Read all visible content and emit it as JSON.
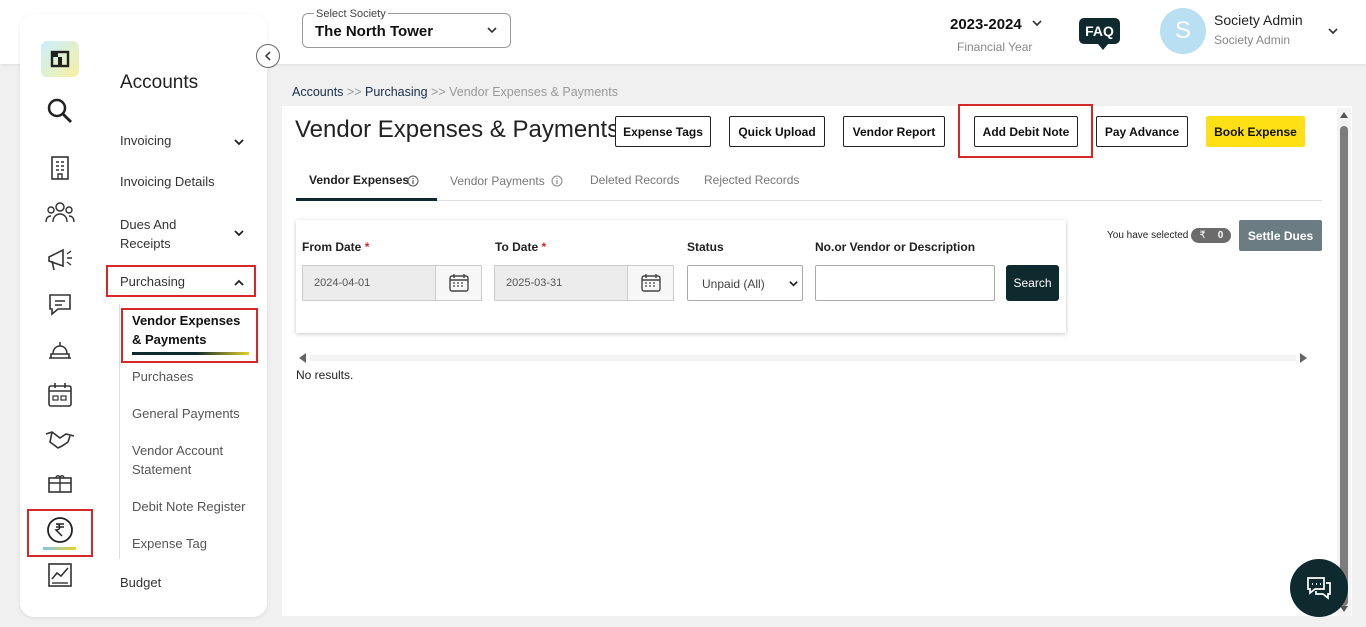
{
  "header": {
    "society_label": "Select Society",
    "society_value": "The North Tower",
    "financial_year": "2023-2024",
    "financial_year_label": "Financial Year",
    "faq_label": "FAQ",
    "user_initial": "S",
    "user_name": "Society Admin",
    "user_role": "Society Admin"
  },
  "sidebar": {
    "section_title": "Accounts",
    "items": {
      "invoicing": "Invoicing",
      "invoicing_details": "Invoicing Details",
      "dues_receipts": "Dues And Receipts",
      "purchasing": "Purchasing",
      "budget": "Budget"
    },
    "purchasing_sub": {
      "vendor_expenses": "Vendor Expenses & Payments",
      "purchases": "Purchases",
      "general_payments": "General Payments",
      "vendor_account_statement": "Vendor Account Statement",
      "debit_note_register": "Debit Note Register",
      "expense_tag": "Expense Tag"
    }
  },
  "breadcrumb": {
    "accounts": "Accounts",
    "sep1": ">>",
    "purchasing": "Purchasing",
    "sep2": ">>",
    "current": "Vendor Expenses & Payments"
  },
  "page": {
    "title": "Vendor Expenses & Payments",
    "buttons": {
      "expense_tags": "Expense Tags",
      "quick_upload": "Quick Upload",
      "vendor_report": "Vendor Report",
      "add_debit_note": "Add Debit Note",
      "pay_advance": "Pay Advance",
      "book_expense": "Book Expense"
    },
    "tabs": {
      "vendor_expenses": "Vendor Expenses",
      "vendor_payments": "Vendor Payments",
      "deleted_records": "Deleted Records",
      "rejected_records": "Rejected Records"
    }
  },
  "filters": {
    "from_date_label": "From Date",
    "from_date_value": "2024-04-01",
    "to_date_label": "To Date",
    "to_date_value": "2025-03-31",
    "required_mark": "*",
    "status_label": "Status",
    "status_value": "Unpaid (All)",
    "search_label": "No.or Vendor or Description",
    "search_value": "",
    "search_button": "Search"
  },
  "selection": {
    "text": "You have selected",
    "currency_symbol": "₹",
    "count": "0",
    "settle_button": "Settle Dues"
  },
  "results": {
    "empty_text": "No results."
  },
  "colors": {
    "accent_yellow": "#ffe014",
    "dark_teal": "#0f2a2e",
    "highlight_red": "#d62828",
    "settle_gray": "#6b7d82"
  }
}
